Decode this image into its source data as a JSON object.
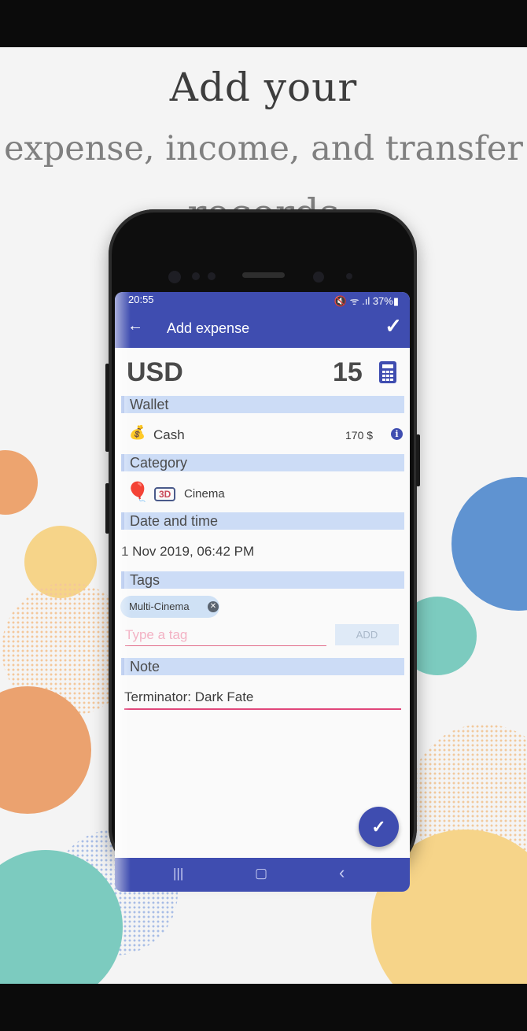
{
  "headline": {
    "line1": "Add your",
    "line2": "expense, income, and transfer",
    "line3": "records"
  },
  "status_bar": {
    "time": "20:55",
    "indicators": "🔇 ᯤ .ıl 37%▮"
  },
  "app_bar": {
    "back_icon": "←",
    "title": "Add expense",
    "confirm_icon": "✓"
  },
  "amount_row": {
    "currency": "USD",
    "amount": "15"
  },
  "wallet": {
    "section_label": "Wallet",
    "icon": "💰",
    "name": "Cash",
    "balance": "170 $",
    "info_icon": "i"
  },
  "category": {
    "section_label": "Category",
    "icon_balloons": "🎈",
    "icon_glasses": "3D",
    "name": "Cinema"
  },
  "date_time": {
    "section_label": "Date and time",
    "value": "1 Nov 2019,  06:42 PM"
  },
  "tags": {
    "section_label": "Tags",
    "chip_label": "Multi-Cinema",
    "chip_remove_icon": "✕",
    "input_placeholder": "Type a tag",
    "add_label": "ADD"
  },
  "note": {
    "section_label": "Note",
    "value": "Terminator: Dark Fate"
  },
  "fab_icon": "✓",
  "nav": {
    "recents": "|||",
    "home": "▢",
    "back": "‹"
  },
  "colors": {
    "primary": "#3f4db0",
    "section_bg": "#ccdcf6",
    "accent_pink": "#e0467a"
  }
}
